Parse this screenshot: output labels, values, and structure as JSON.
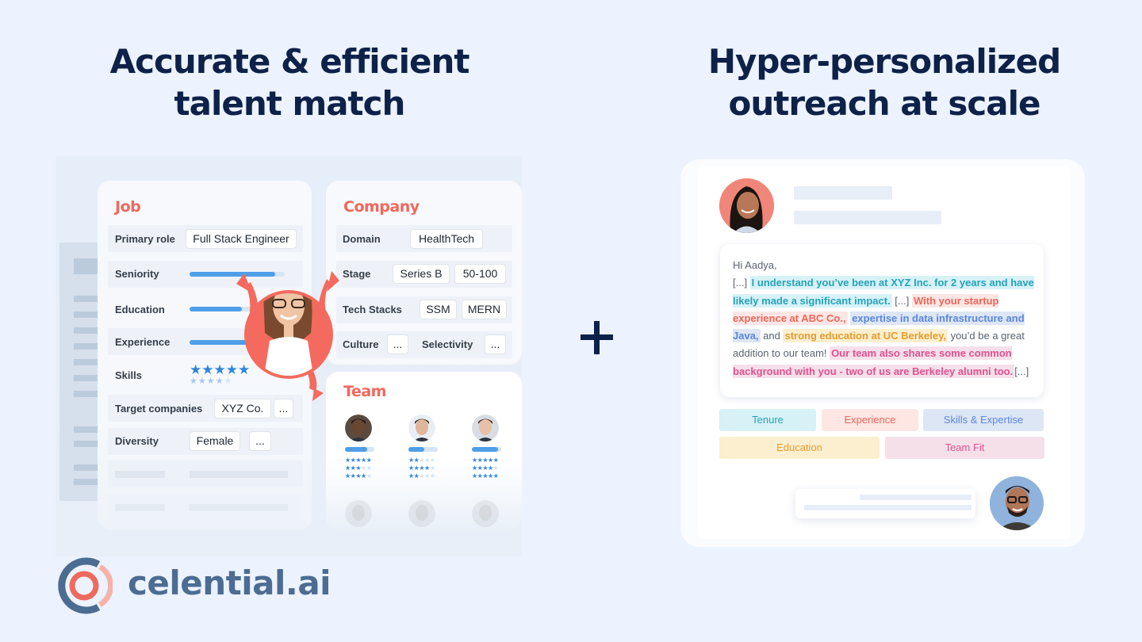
{
  "headlines": {
    "left": [
      "Accurate & efficient",
      "talent match"
    ],
    "right": [
      "Hyper-personalized",
      "outreach at scale"
    ]
  },
  "job_card": {
    "title": "Job",
    "primary_role": {
      "label": "Primary role",
      "value": "Full Stack Engineer"
    },
    "seniority": {
      "label": "Seniority",
      "fill": 0.9
    },
    "education": {
      "label": "Education",
      "fill": 0.55
    },
    "experience": {
      "label": "Experience",
      "fill": 0.8
    },
    "skills": {
      "label": "Skills",
      "primary_stars": 5,
      "secondary_stars": 4,
      "max": 5
    },
    "target_companies": {
      "label": "Target companies",
      "value": "XYZ Co.",
      "more": "..."
    },
    "diversity": {
      "label": "Diversity",
      "value": "Female",
      "more": "..."
    }
  },
  "company_card": {
    "title": "Company",
    "domain": {
      "label": "Domain",
      "value": "HealthTech"
    },
    "stage": {
      "label": "Stage",
      "values": [
        "Series B",
        "50-100"
      ]
    },
    "tech_stacks": {
      "label": "Tech Stacks",
      "values": [
        "SSM",
        "MERN"
      ]
    },
    "culture": {
      "label": "Culture",
      "value": "..."
    },
    "selectivity": {
      "label": "Selectivity",
      "value": "..."
    }
  },
  "team_card": {
    "title": "Team",
    "members": [
      {
        "match": 0.75,
        "ratings": [
          5,
          3,
          4
        ]
      },
      {
        "match": 0.55,
        "ratings": [
          2,
          4,
          2
        ]
      },
      {
        "match": 0.9,
        "ratings": [
          5,
          4,
          5
        ]
      }
    ],
    "rating_max": 5
  },
  "outreach": {
    "greeting": "Hi Aadya,",
    "segments": [
      {
        "text": "[...] ",
        "type": "plain"
      },
      {
        "text": "I understand you’ve been at XYZ Inc. for 2 years and have likely made a significant impact.",
        "type": "tenure"
      },
      {
        "text": " [...] ",
        "type": "plain"
      },
      {
        "text": "With your startup experience at ABC Co.,",
        "type": "experience"
      },
      {
        "text": " ",
        "type": "plain"
      },
      {
        "text": "expertise in data infrastructure and Java,",
        "type": "skills"
      },
      {
        "text": " and ",
        "type": "plain"
      },
      {
        "text": "strong education at UC Berkeley,",
        "type": "education"
      },
      {
        "text": " you’d be a great addition to our team! ",
        "type": "plain"
      },
      {
        "text": "Our team also shares some common background with you - two of us are Berkeley alumni too.",
        "type": "teamfit"
      },
      {
        "text": "[...]",
        "type": "plain"
      }
    ],
    "tags": [
      {
        "label": "Tenure",
        "type": "tenure"
      },
      {
        "label": "Experience",
        "type": "experience"
      },
      {
        "label": "Skills & Expertise",
        "type": "skills"
      },
      {
        "label": "Education",
        "type": "education"
      },
      {
        "label": "Team Fit",
        "type": "teamfit"
      }
    ]
  },
  "colors": {
    "headline": "#0d2149",
    "accent_coral": "#f2675c",
    "star_blue": "#2f86db",
    "bar_blue": "#4f9ee8",
    "logo_blue": "#4c6c92",
    "tenure": "#27a2b9",
    "experience": "#ec6759",
    "skills": "#5b86dc",
    "education": "#e79b2e",
    "teamfit": "#e0508f"
  },
  "brand": {
    "name": "celential.ai"
  }
}
